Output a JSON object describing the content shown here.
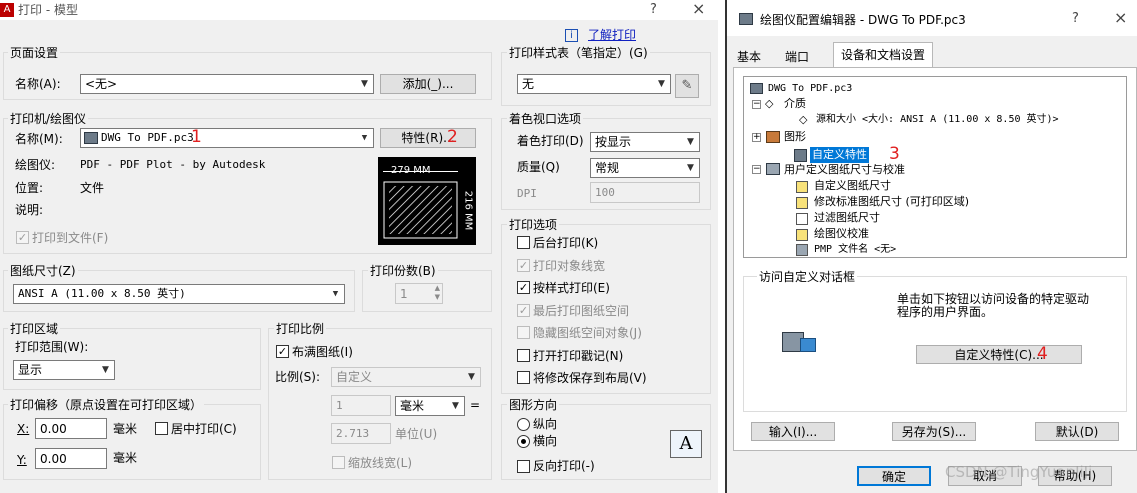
{
  "print": {
    "title": "打印 - 模型",
    "help_icon": "?",
    "close_icon": "×",
    "learn_link": "了解打印",
    "page_setup": {
      "label": "页面设置",
      "name_label": "名称(A):",
      "name_value": "<无>",
      "add_button": "添加(_)..."
    },
    "printer": {
      "label": "打印机/绘图仪",
      "name_label": "名称(M):",
      "name_value": "DWG To PDF.pc3",
      "marker1": "1",
      "props_button": "特性(R)...",
      "marker2": "2",
      "plotter_label": "绘图仪:",
      "plotter_value": "PDF - PDF Plot - by Autodesk",
      "where_label": "位置:",
      "where_value": "文件",
      "desc_label": "说明:",
      "print_to_file": "打印到文件(F)",
      "preview_width": "279 MM",
      "preview_height": "216 MM"
    },
    "paper_size": {
      "label": "图纸尺寸(Z)",
      "value": "ANSI A (11.00 x 8.50 英寸)"
    },
    "copies": {
      "label": "打印份数(B)",
      "value": "1"
    },
    "plot_area": {
      "label": "打印区域",
      "range_label": "打印范围(W):",
      "range_value": "显示"
    },
    "plot_scale": {
      "label": "打印比例",
      "fit_paper": "布满图纸(I)",
      "scale_label": "比例(S):",
      "scale_value": "自定义",
      "num_value": "1",
      "unit_value": "毫米",
      "equals": "=",
      "den_value": "2.713",
      "unit_label": "单位(U)",
      "scale_lw": "缩放线宽(L)"
    },
    "plot_offset": {
      "label": "打印偏移（原点设置在可打印区域）",
      "x_label": "X:",
      "x_value": "0.00",
      "x_unit": "毫米",
      "center": "居中打印(C)",
      "y_label": "Y:",
      "y_value": "0.00",
      "y_unit": "毫米"
    },
    "style_table": {
      "label": "打印样式表（笔指定）(G)",
      "value": "无"
    },
    "shaded": {
      "label": "着色视口选项",
      "shade_label": "着色打印(D)",
      "shade_value": "按显示",
      "quality_label": "质量(Q)",
      "quality_value": "常规",
      "dpi_label": "DPI",
      "dpi_value": "100"
    },
    "options": {
      "label": "打印选项",
      "items": [
        "后台打印(K)",
        "打印对象线宽",
        "按样式打印(E)",
        "最后打印图纸空间",
        "隐藏图纸空间对象(J)",
        "打开打印戳记(N)",
        "将修改保存到布局(V)"
      ]
    },
    "orientation": {
      "label": "图形方向",
      "portrait": "纵向",
      "landscape": "横向",
      "reverse": "反向打印(-)",
      "icon_letter": "A"
    }
  },
  "editor": {
    "title": "绘图仪配置编辑器 - DWG To PDF.pc3",
    "help_icon": "?",
    "close_icon": "×",
    "tabs": [
      "基本",
      "端口",
      "设备和文档设置"
    ],
    "tree": [
      "DWG To PDF.pc3",
      "介质",
      "源和大小 <大小: ANSI A (11.00 x 8.50 英寸)>",
      "图形",
      "自定义特性",
      "用户定义图纸尺寸与校准",
      "自定义图纸尺寸",
      "修改标准图纸尺寸 (可打印区域)",
      "过滤图纸尺寸",
      "绘图仪校准",
      "PMP 文件名 <无>"
    ],
    "marker3": "3",
    "custom_group": "访问自定义对话框",
    "custom_desc_1": "单击如下按钮以访问设备的特定驱动",
    "custom_desc_2": "程序的用户界面。",
    "custom_button": "自定义特性(C)...",
    "marker4": "4",
    "import_button": "输入(I)...",
    "saveas_button": "另存为(S)...",
    "default_button": "默认(D)",
    "ok_button": "确定",
    "cancel_button": "取消",
    "help_button": "帮助(H)",
    "watermark": "CSDN @TingYuanJiJi"
  },
  "colors": {
    "accent": "#0078d7",
    "marker": "#e02020",
    "dialog_bg": "#f0f0f0"
  }
}
